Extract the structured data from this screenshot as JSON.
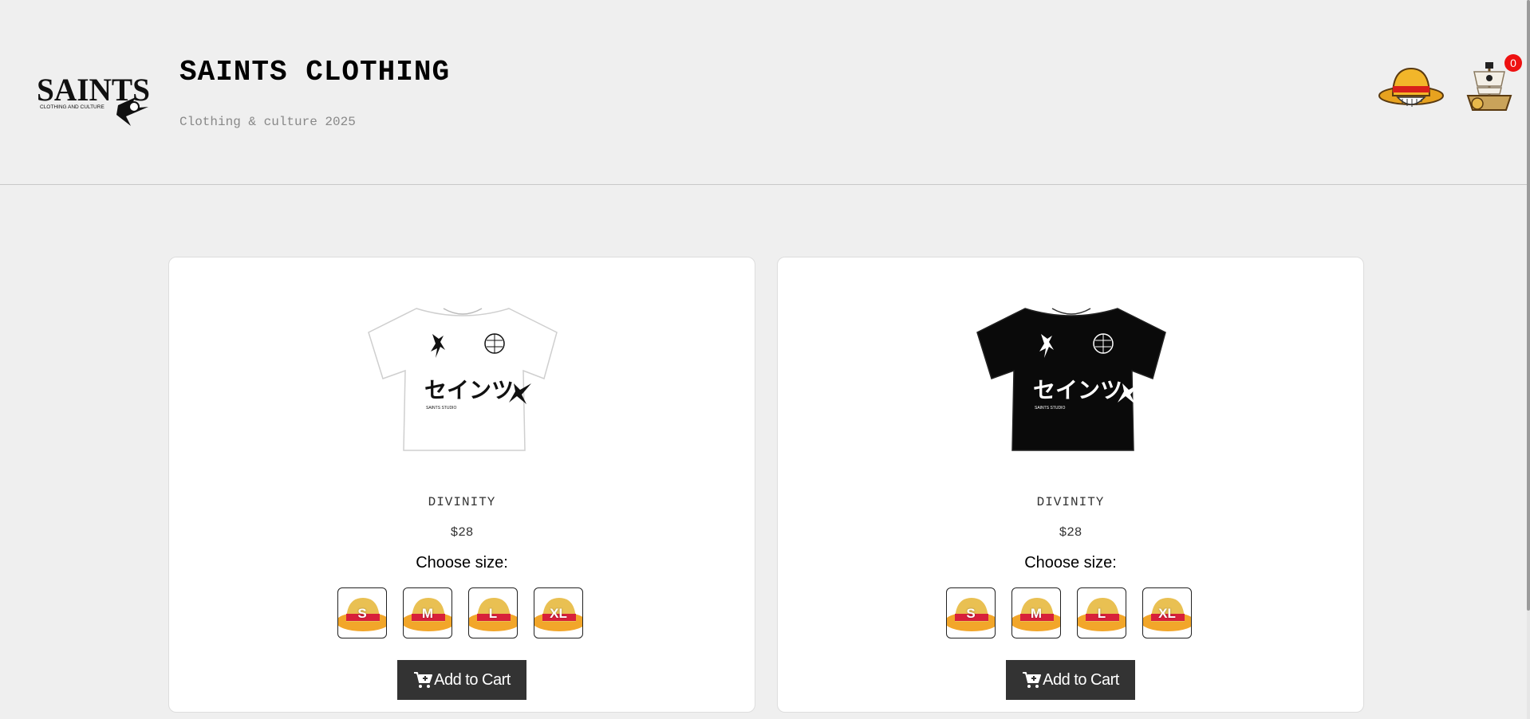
{
  "header": {
    "logo_text": "SAINTS",
    "logo_tagline": "CLOTHING AND CULTURE",
    "title": "SAINTS CLOTHING",
    "subtitle": "Clothing & culture 2025",
    "cart_count": "0"
  },
  "products": [
    {
      "name": "DIVINITY",
      "price": "$28",
      "shirt_color": "#ffffff",
      "print_color": "#111111",
      "print_text": "セインツ",
      "size_label": "Choose size:",
      "sizes": [
        "S",
        "M",
        "L",
        "XL"
      ],
      "add_label": "Add to Cart"
    },
    {
      "name": "DIVINITY",
      "price": "$28",
      "shirt_color": "#0a0a0a",
      "print_color": "#ffffff",
      "print_text": "セインツ",
      "size_label": "Choose size:",
      "sizes": [
        "S",
        "M",
        "L",
        "XL"
      ],
      "add_label": "Add to Cart"
    }
  ],
  "icons": {
    "profile": "straw-hat-icon",
    "cart": "pirate-ship-icon",
    "add_to_cart": "cart-plus-icon",
    "size_background": "straw-hat-icon"
  }
}
